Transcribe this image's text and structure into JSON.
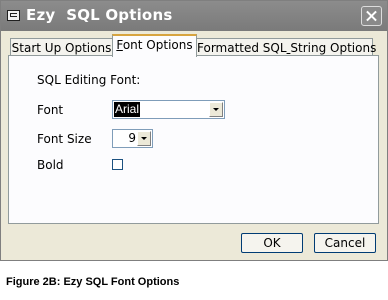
{
  "window": {
    "title": "Ezy  SQL Options",
    "icon": "form-icon",
    "close_icon": "close-icon"
  },
  "tabs": [
    {
      "label": "Start Up Options",
      "selected": false
    },
    {
      "label": "Font Options",
      "selected": true
    },
    {
      "label": "Formatted SQL String Options",
      "selected": false
    }
  ],
  "font_options": {
    "section_label": "SQL Editing Font:",
    "font_label": "Font",
    "font_value": "Arial",
    "font_size_label": "Font Size",
    "font_size_value": "9",
    "bold_label": "Bold",
    "bold_checked": false
  },
  "buttons": {
    "ok": "OK",
    "cancel": "Cancel"
  },
  "caption": "Figure 2B: Ezy SQL Font Options"
}
